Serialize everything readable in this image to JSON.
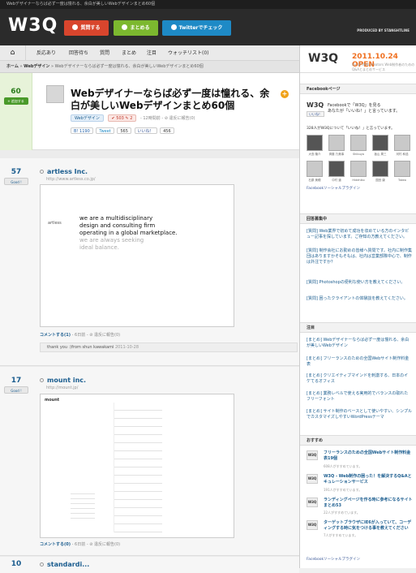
{
  "header": {
    "tagline": "Webデザイナーならば必ず一度は憧れる、余白が美しいWebデザインまとめ60個",
    "logo": "W3Q",
    "buttons": [
      "質問する",
      "まとめる",
      "Twitterでチェック"
    ],
    "produced": "PRODUCED BY STANGHTLINE"
  },
  "nav": [
    "反応あり",
    "回答待ち",
    "質問",
    "まとめ",
    "注目",
    "ウォッチリスト(0)"
  ],
  "breadcrumb": {
    "home": "ホーム",
    "category": "Webデザイン",
    "current": "Webデザイナーならば必ず一度は憧れる、余白が美しいWebデザインまとめ60個"
  },
  "featured": {
    "score": "60",
    "add_label": "+ 追加する",
    "title": "Webデザイナーならば必ず一度は憧れる、余白が美しいWebデザインまとめ60個",
    "tag": "Webデザイン",
    "votes": "✔ 503 ✎ 2",
    "meta": "- 12時間前 - ⊘ 違反に報告(0)",
    "social": [
      "B! 1190",
      "Tweet",
      "565",
      "いいね！",
      "456"
    ]
  },
  "entries": [
    {
      "score": "57",
      "good_label": "Good !",
      "title": "artless Inc.",
      "url": "http://www.artless.co.jp/",
      "shot_brand": "artless",
      "shot_text": [
        "we are a multidisciplinary",
        "design and consulting firm",
        "operating in a global marketplace."
      ],
      "shot_text_light": [
        "we are always seeking",
        "ideal balance."
      ],
      "comment": "コメントする(1)",
      "comment_meta": "- 6日前 - ⊘ 違反に報告(0)",
      "reply": "thank you :)from shun kawakami",
      "reply_date": "2011-10-28"
    },
    {
      "score": "17",
      "good_label": "Good !",
      "title": "mount inc.",
      "url": "http://mount.jp/",
      "shot_brand": "mount",
      "comment": "コメントする(0)",
      "comment_meta": "- 6日前 - ⊘ 違反に報告(0)"
    },
    {
      "score": "10",
      "title": "standardi... "
    }
  ],
  "sidebar": {
    "banner_logo": "W3Q",
    "banner_open": "2011.10.24 OPEN",
    "banner_sub": "for all Web creators   Web制作者のためのQ&Aとまとめサービス",
    "fb_title": "Facebookページ",
    "fb_logo": "W3Q",
    "fb_like": "いいね！",
    "fb_desc": "Facebookで「W3Q」を見る",
    "fb_desc2": "あなたが「いいね！」と言っています。",
    "fb_count": "328人がW3Qについて「いいね！」と言っています。",
    "fb_names": [
      "大島 隆介",
      "斉藤 乃美事",
      "Shibuya",
      "板山 周三",
      "河村 和浩",
      "石原 美穂",
      "中村 道",
      "Hidehiko",
      "国田 康",
      "Takeo"
    ],
    "fb_plugin": "Facebookソーシャルプラグイン",
    "answers_title": "回答募集中",
    "answers": [
      "[質問] Web業界で初めて成功を収めている方のインタビュー記事を探しています。ご存知の方教えてください。",
      "[質問] 制作会社にお勤めの皆様へ質問です。社内に制作集団はありますかそもそもは、社内は営業部隊中心で、制作は外注ですか？",
      "[質問] Photoshopの便利な使い方を教えてください。",
      "[質問] 困ったクライアントの体験談を教えてください。"
    ],
    "attention_title": "注目",
    "attention": [
      "[まとめ] Webデザイナーならば必ず一度は憧れる、余白が美しいWebデザイン",
      "[まとめ] フリーランスのための全国Webサイト制作料金表",
      "[まとめ] クリエイティブマインドを刺激する、日本のイケてるオフィス",
      "[まとめ] 業務レベルで使える実用的でバランスの取れたフリーフォント",
      "[まとめ] サイト制作のベースとして使いやすい、シンプルでカスタマイズしやすいWordPressテーマ"
    ],
    "recommend_title": "おすすめ",
    "recommend": [
      {
        "icon": "W3Q",
        "title": "フリーランスのための全国Webサイト制作料金表19個",
        "count": "608人がすすめています。"
      },
      {
        "icon": "W3Q",
        "title": "W3Q - Web制作の困った！を解決するQ&Aとキュレーションサービス",
        "count": "191人がすすめています。"
      },
      {
        "icon": "W3Q",
        "title": "ランディングページを作る時に参考になるサイトまとめ53",
        "count": "22人がすすめています。"
      },
      {
        "icon": "W3Q",
        "title": "ターゲットブラウザにIE6が入っていて、コーディングする時に気をつける事を教えてください",
        "count": "7人がすすめています。"
      }
    ],
    "fb_plugin2": "Facebookソーシャルプラグイン"
  },
  "colors": {
    "red": "#d8452d",
    "green": "#7cb82f",
    "blue": "#1e8ac6",
    "link": "#1b5d8f"
  }
}
